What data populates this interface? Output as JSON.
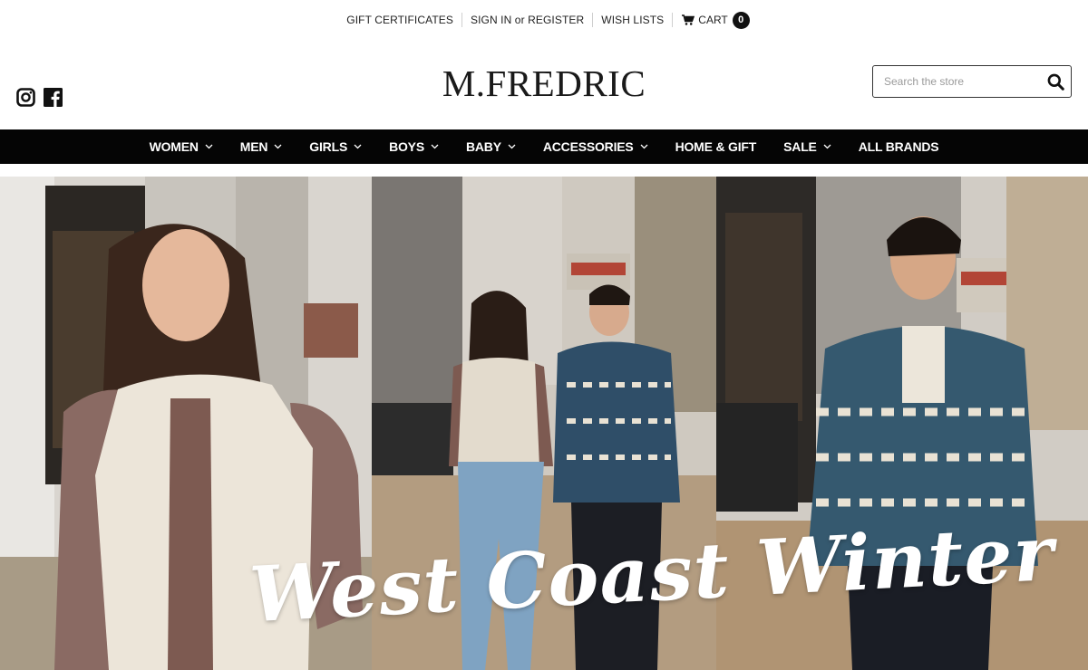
{
  "utility": {
    "gift_certificates": "GIFT CERTIFICATES",
    "sign_in": "SIGN IN",
    "or": "or",
    "register": "REGISTER",
    "wish_lists": "WISH LISTS",
    "cart_label": "CART",
    "cart_count": "0"
  },
  "header": {
    "logo": "M.FREDRIC",
    "social_icons": [
      "instagram-icon",
      "facebook-icon"
    ]
  },
  "search": {
    "placeholder": "Search the store",
    "value": ""
  },
  "nav": {
    "items": [
      {
        "label": "WOMEN",
        "dropdown": true
      },
      {
        "label": "MEN",
        "dropdown": true
      },
      {
        "label": "GIRLS",
        "dropdown": true
      },
      {
        "label": "BOYS",
        "dropdown": true
      },
      {
        "label": "BABY",
        "dropdown": true
      },
      {
        "label": "ACCESSORIES",
        "dropdown": true
      },
      {
        "label": "HOME & GIFT",
        "dropdown": false
      },
      {
        "label": "SALE",
        "dropdown": true
      },
      {
        "label": "ALL BRANDS",
        "dropdown": false
      }
    ]
  },
  "hero": {
    "title": "West Coast Winter"
  },
  "colors": {
    "nav_background": "#050505",
    "badge_background": "#111111",
    "text": "#222222"
  }
}
